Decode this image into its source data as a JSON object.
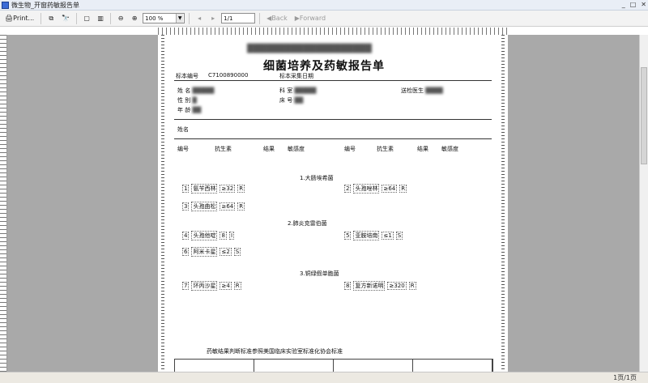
{
  "window": {
    "title": "微生物_开窗药敏报告单"
  },
  "toolbar": {
    "print_label": "Print...",
    "zoom_value": "100 %",
    "page_value": "1/1",
    "back_label": "Back",
    "forward_label": "Forward"
  },
  "report": {
    "blurred_header": "████████████████████",
    "title": "细菌培养及药敏报告单",
    "sample_label": "标本编号",
    "sample_no": "C7100890000",
    "collect_label": "标本采集日期",
    "name_label": "姓名",
    "section1": "1.大肠埃希菌",
    "section2": "2.肺炎克雷伯菌",
    "section3": "3.铜绿假单胞菌",
    "footer": "药敏结果判断标准参照美国临床实验室标准化协会标准"
  },
  "columns": [
    "编号",
    "抗生素",
    "结果",
    "敏感度"
  ],
  "fields": [
    {
      "label": "姓 名",
      "value": "█████"
    },
    {
      "label": "性 别",
      "value": "█"
    },
    {
      "label": "年 龄",
      "value": "██"
    },
    {
      "label": "科 室",
      "value": "█████"
    },
    {
      "label": "床 号",
      "value": "██"
    },
    {
      "label": "送检医生",
      "value": "████"
    }
  ],
  "rows": [
    [
      "1",
      "氨苄西林",
      "≥32",
      "R"
    ],
    [
      "2",
      "头孢唑林",
      "≥64",
      "R"
    ],
    [
      "3",
      "头孢曲松",
      "≥64",
      "R"
    ],
    [
      "4",
      "头孢他啶",
      "8",
      "I"
    ],
    [
      "5",
      "亚胺培南",
      "≤1",
      "S"
    ],
    [
      "6",
      "阿米卡星",
      "≤2",
      "S"
    ],
    [
      "7",
      "环丙沙星",
      "≥4",
      "R"
    ],
    [
      "8",
      "复方新诺明",
      "≥320",
      "R"
    ]
  ],
  "status": {
    "page": "1页/1页"
  }
}
